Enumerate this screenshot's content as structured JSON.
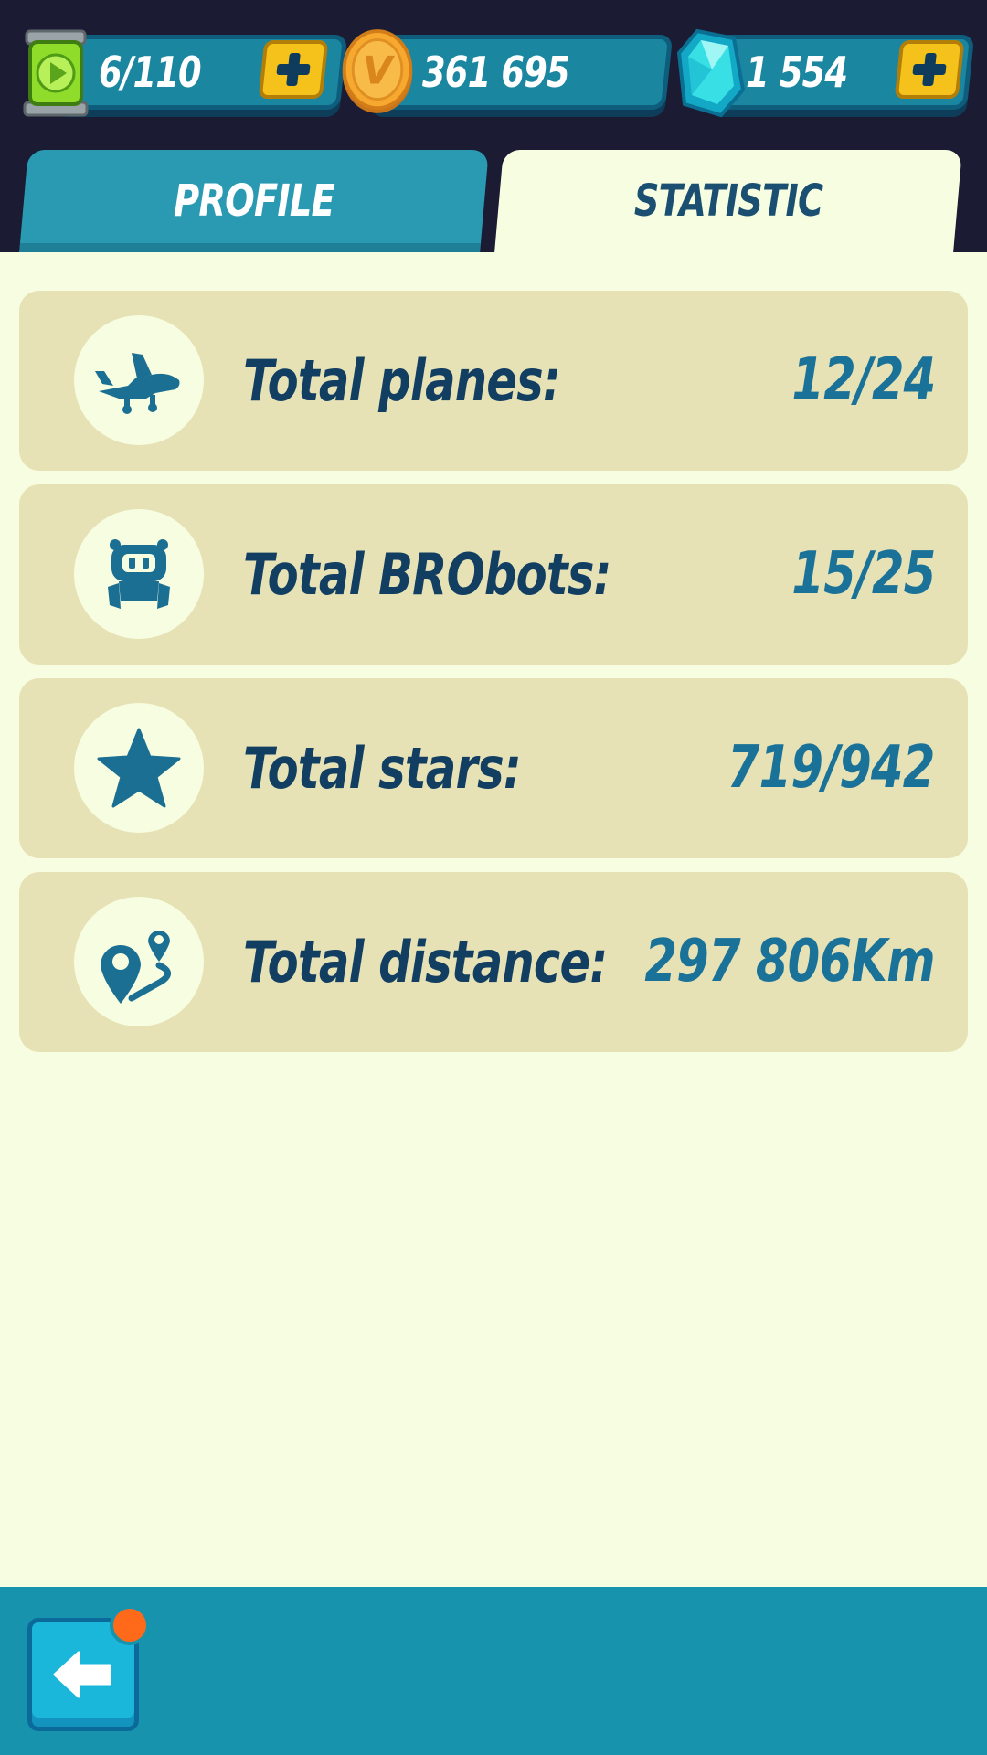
{
  "resources": {
    "energy": {
      "value": "6/110",
      "icon": "energy-battery-icon"
    },
    "coins": {
      "value": "361 695",
      "icon": "coin-icon",
      "coin_letter": "V"
    },
    "gems": {
      "value": "1 554",
      "icon": "gem-icon"
    }
  },
  "tabs": [
    {
      "label": "PROFILE",
      "active": false
    },
    {
      "label": "STATISTIC",
      "active": true
    }
  ],
  "stats": [
    {
      "label": "Total planes:",
      "value": "12/24",
      "icon": "plane-icon"
    },
    {
      "label": "Total BRObots:",
      "value": "15/25",
      "icon": "robot-icon"
    },
    {
      "label": "Total stars:",
      "value": "719/942",
      "icon": "star-icon"
    },
    {
      "label": "Total distance:",
      "value": "297 806Km",
      "icon": "route-pins-icon"
    }
  ],
  "colors": {
    "accent": "#1793ad",
    "text_dark": "#123e62",
    "value_blue": "#1a7299",
    "plus_yellow": "#f5c21b",
    "notification": "#ff6a1a"
  }
}
